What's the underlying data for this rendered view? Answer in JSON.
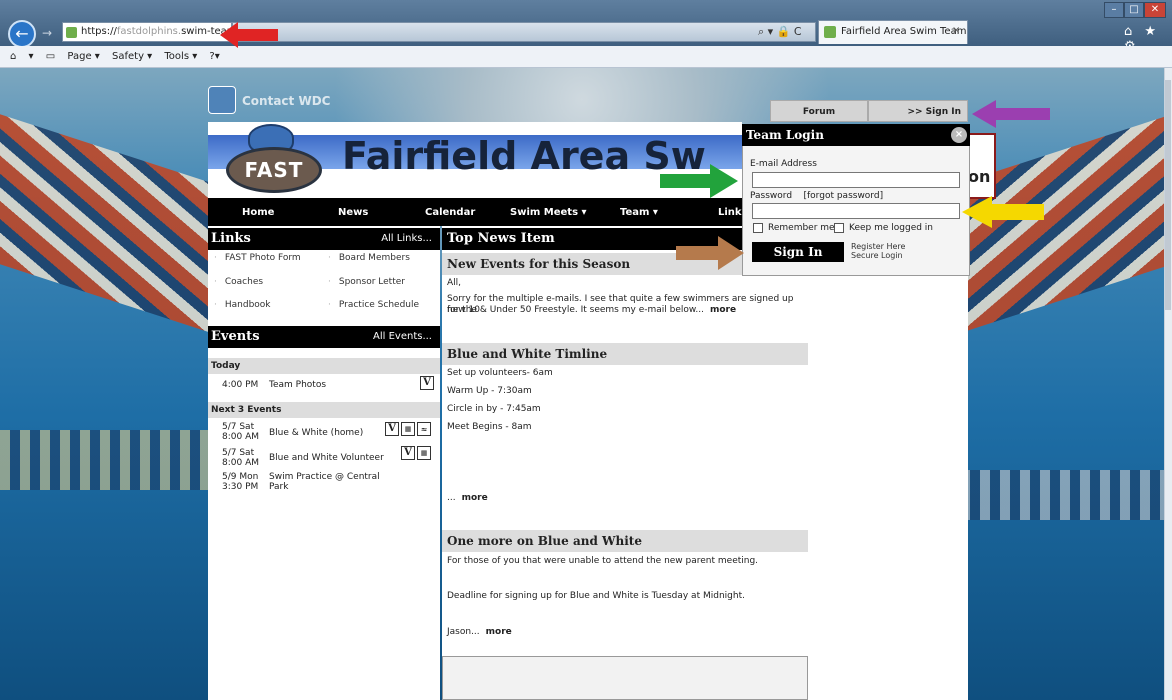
{
  "browser": {
    "url_prefix": "https://",
    "url_host": "fastdolphins.",
    "url_rest": "swim-team.us/",
    "tab_title": "Fairfield Area Swim Team",
    "tab_close": "×",
    "back": "←",
    "forward": "→",
    "addr_tools": "⌕ ▾ 🔒 C",
    "window_controls": [
      "–",
      "□",
      "✕"
    ],
    "right_icons": "⌂ ★ ⚙",
    "command_bar": [
      "▾",
      "Page ▾",
      "Safety ▾",
      "Tools ▾",
      "?▾"
    ]
  },
  "site": {
    "contact_label": "Contact WDC",
    "title": "Fairfield Area Sw",
    "logo_text": "FAST",
    "nav": [
      "Home",
      "News",
      "Calendar",
      "Swim Meets ▾",
      "Team ▾",
      "Links"
    ],
    "right_box_text": "on"
  },
  "tabs": {
    "forum": "Forum",
    "signin": ">> Sign In"
  },
  "links": {
    "title": "Links",
    "all": "All Links...",
    "items": [
      "FAST Photo Form",
      "Board Members",
      "Coaches",
      "Sponsor Letter",
      "Handbook",
      "Practice Schedule"
    ]
  },
  "events": {
    "title": "Events",
    "all": "All Events...",
    "today_label": "Today",
    "today": {
      "time": "4:00 PM",
      "name": "Team Photos"
    },
    "next_label": "Next 3 Events",
    "next": [
      {
        "date": "5/7 Sat",
        "time": "8:00 AM",
        "name": "Blue & White (home)"
      },
      {
        "date": "5/7 Sat",
        "time": "8:00 AM",
        "name": "Blue and White Volunteer"
      },
      {
        "date": "5/9 Mon",
        "time": "3:30 PM",
        "name": "Swim Practice @ Central",
        "name2": "Park"
      }
    ],
    "badge": "V"
  },
  "news": {
    "header": "Top News Item",
    "items": [
      {
        "title": "New Events for this Season",
        "lines": [
          "All,",
          "Sorry for the multiple e-mails. I see that quite a few swimmers are signed up for the",
          "new 10& Under 50 Freestyle. It seems my e-mail below..."
        ],
        "more": "more"
      },
      {
        "title": "Blue and White Timline",
        "lines": [
          "Set up volunteers- 6am",
          "Warm Up - 7:30am",
          "Circle in by - 7:45am",
          "Meet Begins - 8am",
          "..."
        ],
        "more": "more"
      },
      {
        "title": "One more on Blue and White",
        "lines": [
          "For those of you that were unable to attend the new parent meeting.",
          "Deadline for signing up for Blue and White is Tuesday at Midnight.",
          "Jason..."
        ],
        "more": "more"
      }
    ]
  },
  "login": {
    "title": "Team Login",
    "close": "×",
    "email_label": "E-mail Address",
    "email_value": "",
    "password_label": "Password",
    "forgot": "[forgot password]",
    "password_value": "",
    "remember": "Remember me",
    "keep": "Keep me logged in",
    "signin_button": "Sign In",
    "register": "Register Here",
    "secure": "Secure Login"
  },
  "colors": {
    "arrow_red": "#e02424",
    "arrow_purple": "#9b3fb0",
    "arrow_green": "#22a33c",
    "arrow_yellow": "#f5d800",
    "arrow_brown": "#b57a4c"
  }
}
